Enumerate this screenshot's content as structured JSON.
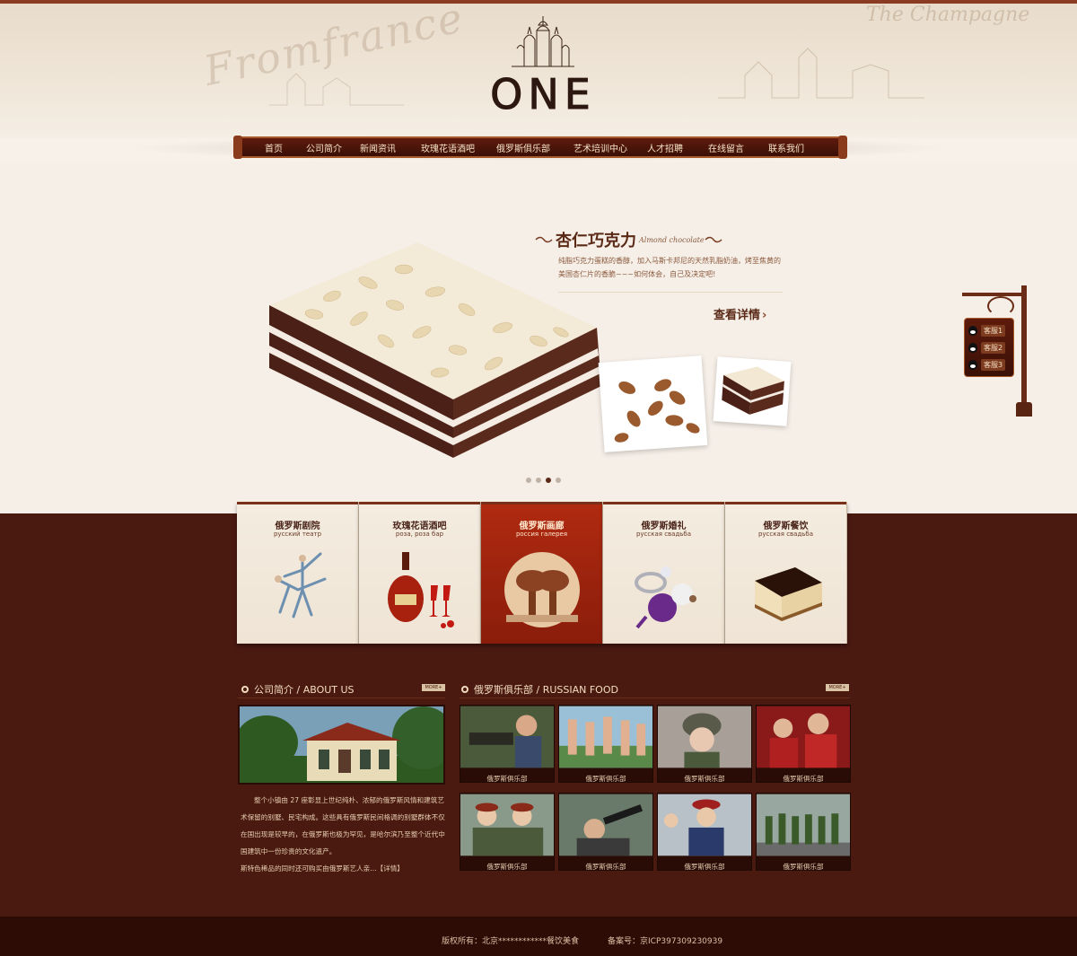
{
  "header": {
    "logo_text": "ONE",
    "script_left": "Fromfrance",
    "script_right": "The Champagne"
  },
  "nav": {
    "items": [
      "首页",
      "公司简介",
      "新闻资讯",
      "玫瑰花语酒吧",
      "俄罗斯俱乐部",
      "艺术培训中心",
      "人才招聘",
      "在线留言",
      "联系我们"
    ]
  },
  "banner": {
    "title": "杏仁巧克力",
    "subtitle": "Almond chocolate",
    "description": "纯脂巧克力蛋糕的香醇，加入马斯卡邦尼的天然乳脂奶油，烤至焦黄的美国杏仁片的香脆~~~如何体会，自己及决定吧!",
    "detail_label": "查看详情",
    "slides": 4,
    "active_slide": 3
  },
  "service": {
    "items": [
      "客服1",
      "客服2",
      "客服3"
    ]
  },
  "cards": [
    {
      "title": "俄罗斯剧院",
      "sub": "русский  театр"
    },
    {
      "title": "玫瑰花语酒吧",
      "sub": "роза, роза  бар"
    },
    {
      "title": "俄罗斯画廊",
      "sub": "россия  галерея"
    },
    {
      "title": "俄罗斯婚礼",
      "sub": "русская  свадьба"
    },
    {
      "title": "俄罗斯餐饮",
      "sub": "русская  свадьба"
    }
  ],
  "about": {
    "title": "公司简介 / ABOUT US",
    "more": "MORE+",
    "text": "整个小镇由 27 座彰显上世纪纯朴、浓郁的俄罗斯风情和建筑艺术保留的别墅、民宅构成。这些具有俄罗斯民间格调的别墅群体不仅在国出现是较早的，在俄罗斯也极为罕见，是哈尔滨乃至整个近代中国建筑中一份珍贵的文化遗产。",
    "text2": "斯特色稀品的同时还可购买由俄罗斯艺人亲...【详情】"
  },
  "russian_food": {
    "title": "俄罗斯俱乐部 / RUSSIAN FOOD",
    "more": "MORE+",
    "photos": [
      "俄罗斯俱乐部",
      "俄罗斯俱乐部",
      "俄罗斯俱乐部",
      "俄罗斯俱乐部",
      "俄罗斯俱乐部",
      "俄罗斯俱乐部",
      "俄罗斯俱乐部",
      "俄罗斯俱乐部"
    ]
  },
  "footer": {
    "copyright": "版权所有：北京************餐饮美食",
    "icp": "备案号：京ICP397309230939"
  },
  "colors": {
    "accent_brown": "#4a1a10",
    "nav_dark": "#3a0f06",
    "active_card": "#b02a10",
    "text_light": "#f3dcc0"
  }
}
